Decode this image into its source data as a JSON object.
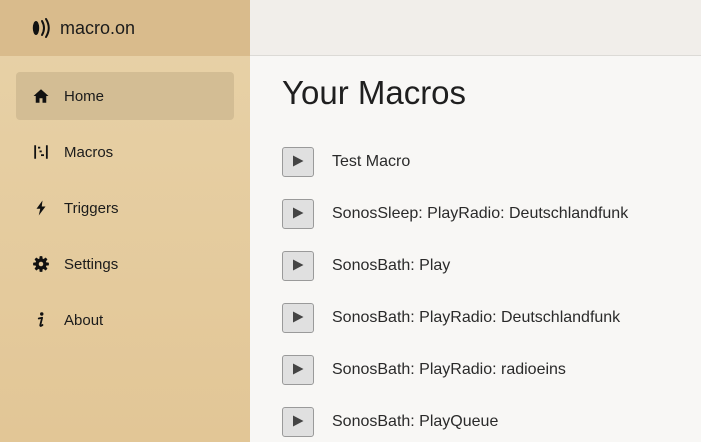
{
  "brand": {
    "name": "macro.on",
    "icon": "sound-waves-icon"
  },
  "nav": {
    "items": [
      {
        "label": "Home",
        "icon": "home-icon",
        "active": true
      },
      {
        "label": "Macros",
        "icon": "macros-icon",
        "active": false
      },
      {
        "label": "Triggers",
        "icon": "bolt-icon",
        "active": false
      },
      {
        "label": "Settings",
        "icon": "gear-icon",
        "active": false
      },
      {
        "label": "About",
        "icon": "info-icon",
        "active": false
      }
    ]
  },
  "main": {
    "title": "Your Macros",
    "macros": [
      {
        "name": "Test Macro"
      },
      {
        "name": "SonosSleep: PlayRadio: Deutschlandfunk"
      },
      {
        "name": "SonosBath: Play"
      },
      {
        "name": "SonosBath: PlayRadio: Deutschlandfunk"
      },
      {
        "name": "SonosBath: PlayRadio: radioeins"
      },
      {
        "name": "SonosBath: PlayQueue"
      }
    ]
  },
  "colors": {
    "sidebar": "#e5cb9d",
    "brand_bar": "#d9bb8c",
    "active_item": "#d3bd94",
    "content_bg": "#f8f7f5"
  }
}
